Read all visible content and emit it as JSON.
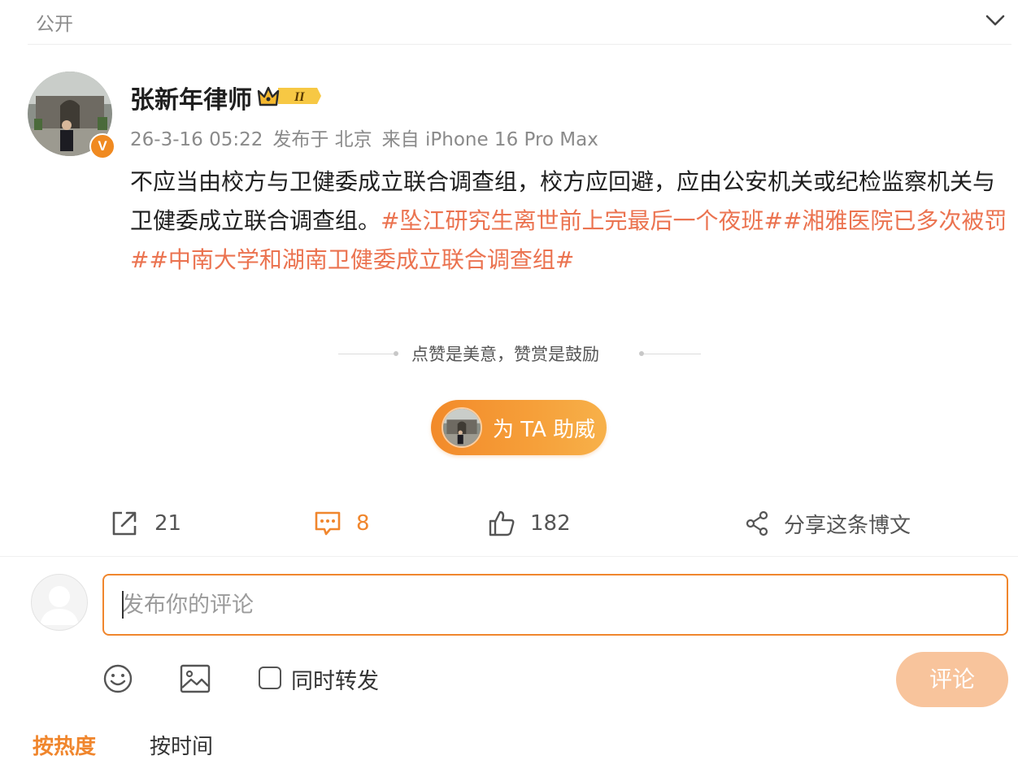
{
  "header": {
    "visibility": "公开"
  },
  "post": {
    "author": "张新年律师",
    "badge_level": "II",
    "verified_mark": "V",
    "time": "26-3-16 05:22",
    "location": "发布于 北京",
    "source": "来自 iPhone 16 Pro Max",
    "body": "不应当由校方与卫健委成立联合调查组，校方应回避，应由公安机关或纪检监察机关与卫健委成立联合调查组。",
    "hashtags": [
      "#坠江研究生离世前上完最后一个夜班#",
      "#湘雅医院已多次被罚#",
      "#中南大学和湖南卫健委成立联合调查组#"
    ]
  },
  "reward": {
    "tagline": "点赞是美意，赞赏是鼓励",
    "button_label": "为 TA 助威"
  },
  "actions": {
    "repost_count": "21",
    "comment_count": "8",
    "like_count": "182",
    "share_label": "分享这条博文"
  },
  "compose": {
    "placeholder": "发布你的评论",
    "repost_label": "同时转发",
    "submit_label": "评论"
  },
  "sort": {
    "hot": "按热度",
    "time": "按时间"
  },
  "colors": {
    "accent": "#f0862d",
    "hashtag": "#eb7350",
    "submit_disabled": "#f8c49c"
  }
}
